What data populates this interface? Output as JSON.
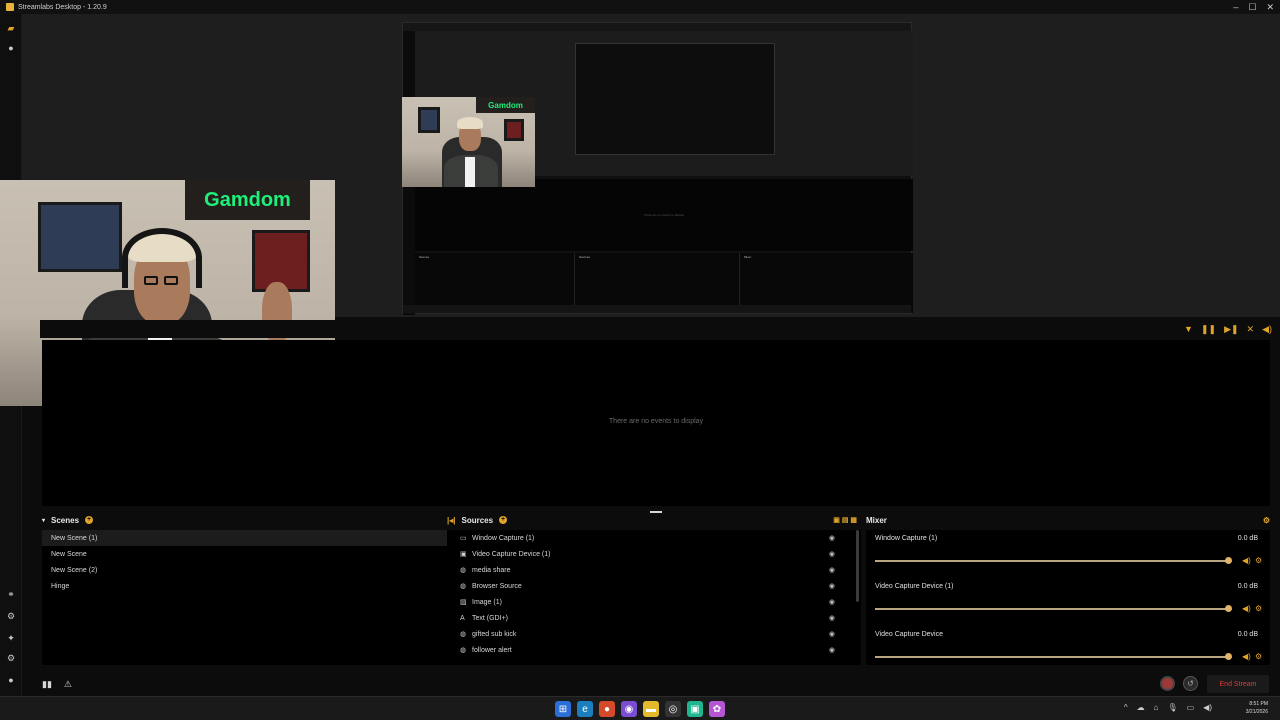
{
  "window": {
    "title": "Streamlabs Desktop - 1.20.9",
    "controls": [
      "–",
      "☐",
      "✕"
    ]
  },
  "events": {
    "empty_text": "There are no events to display",
    "toolbar_icons": [
      "filter-icon",
      "pause-icon",
      "skip-icon",
      "settings-icon",
      "volume-icon"
    ]
  },
  "mini_preview": {
    "empty_text": "There are no events to display",
    "scenes_label": "Scenes",
    "sources_label": "Sources",
    "mixer_label": "Mixer"
  },
  "scenes": {
    "title": "Scenes",
    "items": [
      "New Scene (1)",
      "New Scene",
      "New Scene (2)",
      "Hinge"
    ],
    "selected_index": 0
  },
  "sources": {
    "title": "Sources",
    "items": [
      {
        "label": "Window Capture (1)",
        "icon": "window-icon"
      },
      {
        "label": "Video Capture Device (1)",
        "icon": "camera-icon"
      },
      {
        "label": "media share",
        "icon": "globe-icon"
      },
      {
        "label": "Browser Source",
        "icon": "globe-icon"
      },
      {
        "label": "Image (1)",
        "icon": "image-icon"
      },
      {
        "label": "Text (GDI+)",
        "icon": "text-icon"
      },
      {
        "label": "gifted sub kick",
        "icon": "globe-icon"
      },
      {
        "label": "follower alert",
        "icon": "globe-icon"
      }
    ]
  },
  "mixer": {
    "title": "Mixer",
    "items": [
      {
        "name": "Window Capture (1)",
        "db": "0.0 dB",
        "level": 1.0
      },
      {
        "name": "Video Capture Device (1)",
        "db": "0.0 dB",
        "level": 1.0
      },
      {
        "name": "Video Capture Device",
        "db": "0.0 dB",
        "level": 1.0
      }
    ]
  },
  "webcam": {
    "sign_text": "Gamdom"
  },
  "footer": {
    "end_stream_label": "End Stream"
  },
  "taskbar": {
    "time": "8:51 PM",
    "date": "3/21/2026"
  },
  "colors": {
    "accent": "#e0a42a",
    "end_stream": "#e03a3a",
    "background": "#0c0c0c"
  }
}
